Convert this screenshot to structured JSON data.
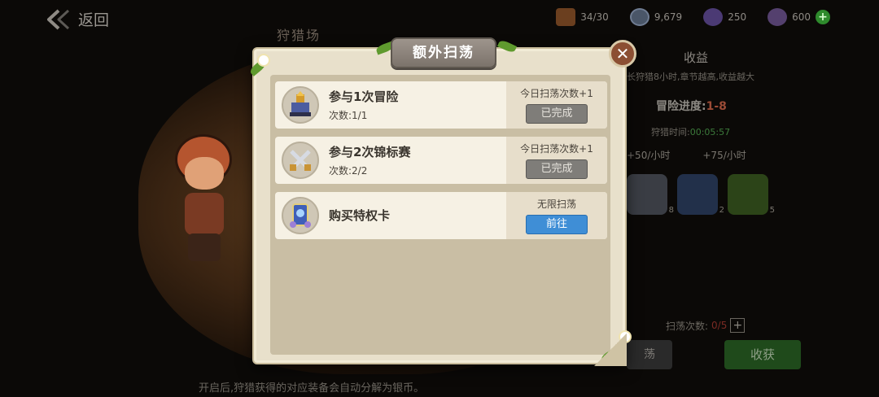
{
  "topbar": {
    "back_label": "返回",
    "resources": [
      {
        "icon": "wood-icon",
        "value": "34/30"
      },
      {
        "icon": "silver-coin-icon",
        "value": "9,679"
      },
      {
        "icon": "purple-gem-icon",
        "value": "250"
      },
      {
        "icon": "amethyst-icon",
        "value": "600"
      }
    ],
    "plus_label": "+"
  },
  "scene": {
    "hunt_title": "狩猎场",
    "footer_note": "开启后,狩猎获得的对应装备会自动分解为银币。"
  },
  "income": {
    "title": "收益",
    "desc": "长狩猎8小时,章节越高,收益越大",
    "progress_label": "冒险进度:",
    "progress_value": "1-8",
    "time_label": "狩猎时间:",
    "time_value": "00:05:57",
    "rate1": "+50/小时",
    "rate2": "+75/小时",
    "items": [
      {
        "count": "8"
      },
      {
        "count": "2"
      },
      {
        "count": "5"
      }
    ],
    "sweep_label": "扫荡次数:",
    "sweep_value": "0/5",
    "collect_label": "收获",
    "dim_label": "荡"
  },
  "modal": {
    "title": "额外扫荡",
    "close_label": "✕",
    "tasks": [
      {
        "name": "参与1次冒险",
        "count": "次数:1/1",
        "reward": "今日扫荡次数+1",
        "button": "已完成",
        "state": "done",
        "icon": "tower-icon"
      },
      {
        "name": "参与2次锦标赛",
        "count": "次数:2/2",
        "reward": "今日扫荡次数+1",
        "button": "已完成",
        "state": "done",
        "icon": "crossed-swords-icon"
      },
      {
        "name": "购买特权卡",
        "count": "",
        "reward": "无限扫荡",
        "button": "前往",
        "state": "go",
        "icon": "privilege-card-icon"
      }
    ]
  },
  "colors": {
    "parchment": "#e8e0cb",
    "done_button": "#7f7d79",
    "go_button": "#3f8ed6",
    "close_button": "#8c4f33"
  }
}
